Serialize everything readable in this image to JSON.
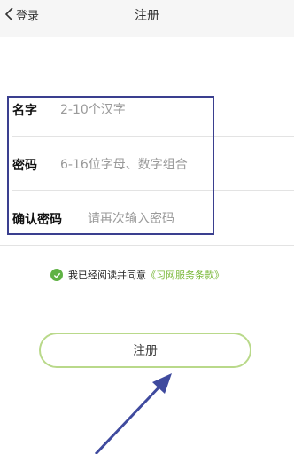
{
  "navbar": {
    "back_label": "登录",
    "title": "注册",
    "back_icon": "chevron-left-icon"
  },
  "form": {
    "name": {
      "label": "名字",
      "placeholder": "2-10个汉字"
    },
    "password": {
      "label": "密码",
      "placeholder": "6-16位字母、数字组合"
    },
    "confirm": {
      "label": "确认密码",
      "placeholder": "请再次输入密码"
    }
  },
  "agreement": {
    "text": "我已经阅读并同意",
    "link": "《习网服务条款》",
    "checked": true
  },
  "register_button": {
    "label": "注册"
  },
  "colors": {
    "accent_green": "#7ab83a",
    "check_green": "#5fb244",
    "button_border": "#b9d98a",
    "highlight_blue": "#3a3f8f"
  }
}
